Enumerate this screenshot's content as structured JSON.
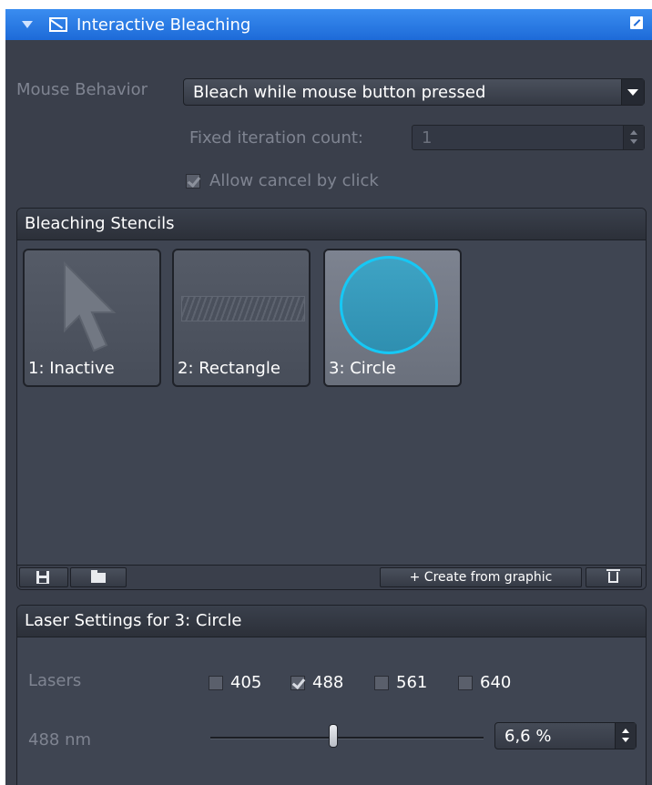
{
  "panel": {
    "title": "Interactive Bleaching",
    "accent_color": "#2a7de6"
  },
  "mouse_behavior": {
    "label": "Mouse Behavior",
    "value": "Bleach while mouse button pressed"
  },
  "fixed_iteration": {
    "label": "Fixed iteration count:",
    "value": "1"
  },
  "allow_cancel": {
    "label": "Allow cancel by click",
    "checked": true
  },
  "stencils": {
    "heading": "Bleaching Stencils",
    "items": [
      {
        "label": "1: Inactive",
        "icon": "arrow-cursor-icon",
        "selected": false
      },
      {
        "label": "2: Rectangle",
        "icon": "rectangle-icon",
        "selected": false
      },
      {
        "label": "3: Circle",
        "icon": "circle-icon",
        "selected": true
      }
    ],
    "toolbar": {
      "save_icon": "save-icon",
      "open_icon": "folder-icon",
      "create_label": "+ Create from graphic",
      "delete_icon": "trash-icon"
    }
  },
  "laser_settings": {
    "heading": "Laser Settings for 3: Circle",
    "lasers_label": "Lasers",
    "lasers": [
      {
        "label": "405",
        "checked": false
      },
      {
        "label": "488",
        "checked": true
      },
      {
        "label": "561",
        "checked": false
      },
      {
        "label": "640",
        "checked": false
      }
    ],
    "power": {
      "label": "488 nm",
      "value_text": "6,6 %",
      "slider_fraction": 0.45
    }
  }
}
